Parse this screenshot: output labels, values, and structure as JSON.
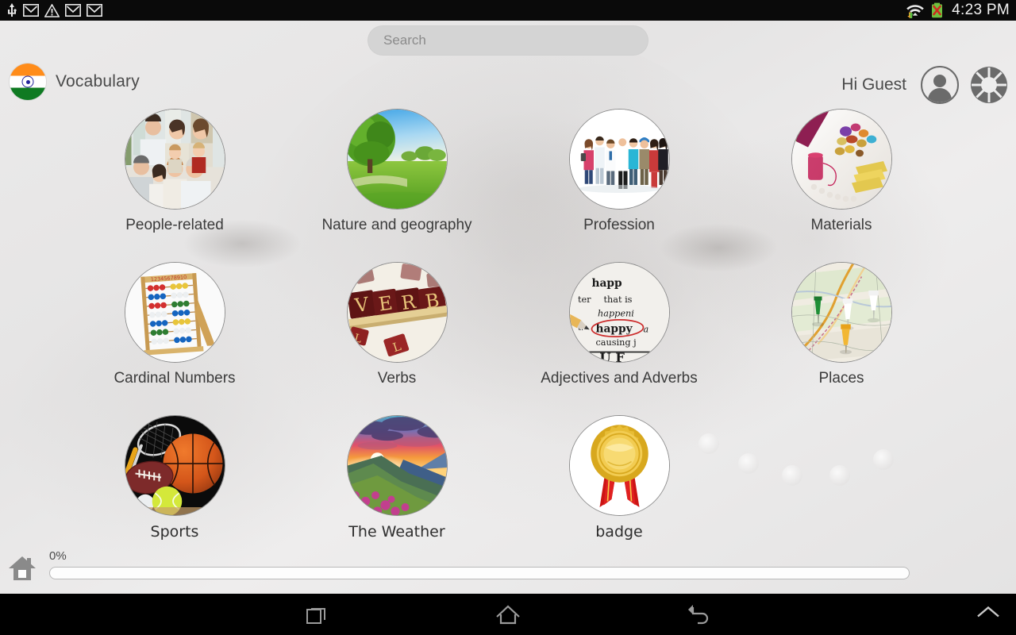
{
  "statusbar": {
    "time": "4:23 PM",
    "left_icons": [
      "usb-icon",
      "gmail-icon",
      "warning-icon",
      "gmail-icon",
      "gmail-icon"
    ],
    "right_icons": [
      "wifi-icon",
      "battery-error-icon"
    ]
  },
  "search": {
    "placeholder": "Search",
    "value": ""
  },
  "header": {
    "flag_icon": "india-flag-icon",
    "app_title": "Vocabulary",
    "greeting": "Hi Guest",
    "avatar_icon": "user-avatar-icon",
    "settings_icon": "gear-icon"
  },
  "topics": [
    {
      "label": "People-related",
      "image": "family-photo",
      "font": "thin"
    },
    {
      "label": "Nature and geography",
      "image": "tree-meadow-photo",
      "font": "thin"
    },
    {
      "label": "Profession",
      "image": "workers-group-photo",
      "font": "thin"
    },
    {
      "label": "Materials",
      "image": "gems-thread-photo",
      "font": "thin"
    },
    {
      "label": "Cardinal Numbers",
      "image": "abacus-photo",
      "font": "thin"
    },
    {
      "label": "Verbs",
      "image": "verb-tiles-photo",
      "font": "thin"
    },
    {
      "label": "Adjectives and Adverbs",
      "image": "dictionary-happy-photo",
      "font": "thin"
    },
    {
      "label": "Places",
      "image": "map-pins-photo",
      "font": "thin"
    },
    {
      "label": "Sports",
      "image": "sports-balls-photo",
      "font": "alt"
    },
    {
      "label": "The Weather",
      "image": "sunset-mountain-photo",
      "font": "alt"
    },
    {
      "label": "badge",
      "image": "gold-badge-photo",
      "font": "alt"
    }
  ],
  "footer": {
    "home_icon": "home-icon",
    "progress_label": "0%",
    "progress_value": 0
  },
  "navbar": {
    "recents_icon": "recents-icon",
    "home_icon": "home-icon",
    "back_icon": "back-icon",
    "expand_icon": "chevron-up-icon"
  },
  "colors": {
    "accent_saffron": "#ff8c1a",
    "accent_green": "#0f7a22",
    "chakra_blue": "#23249c",
    "page_bg": "#e9e9e9",
    "nav_bg": "#000000"
  }
}
